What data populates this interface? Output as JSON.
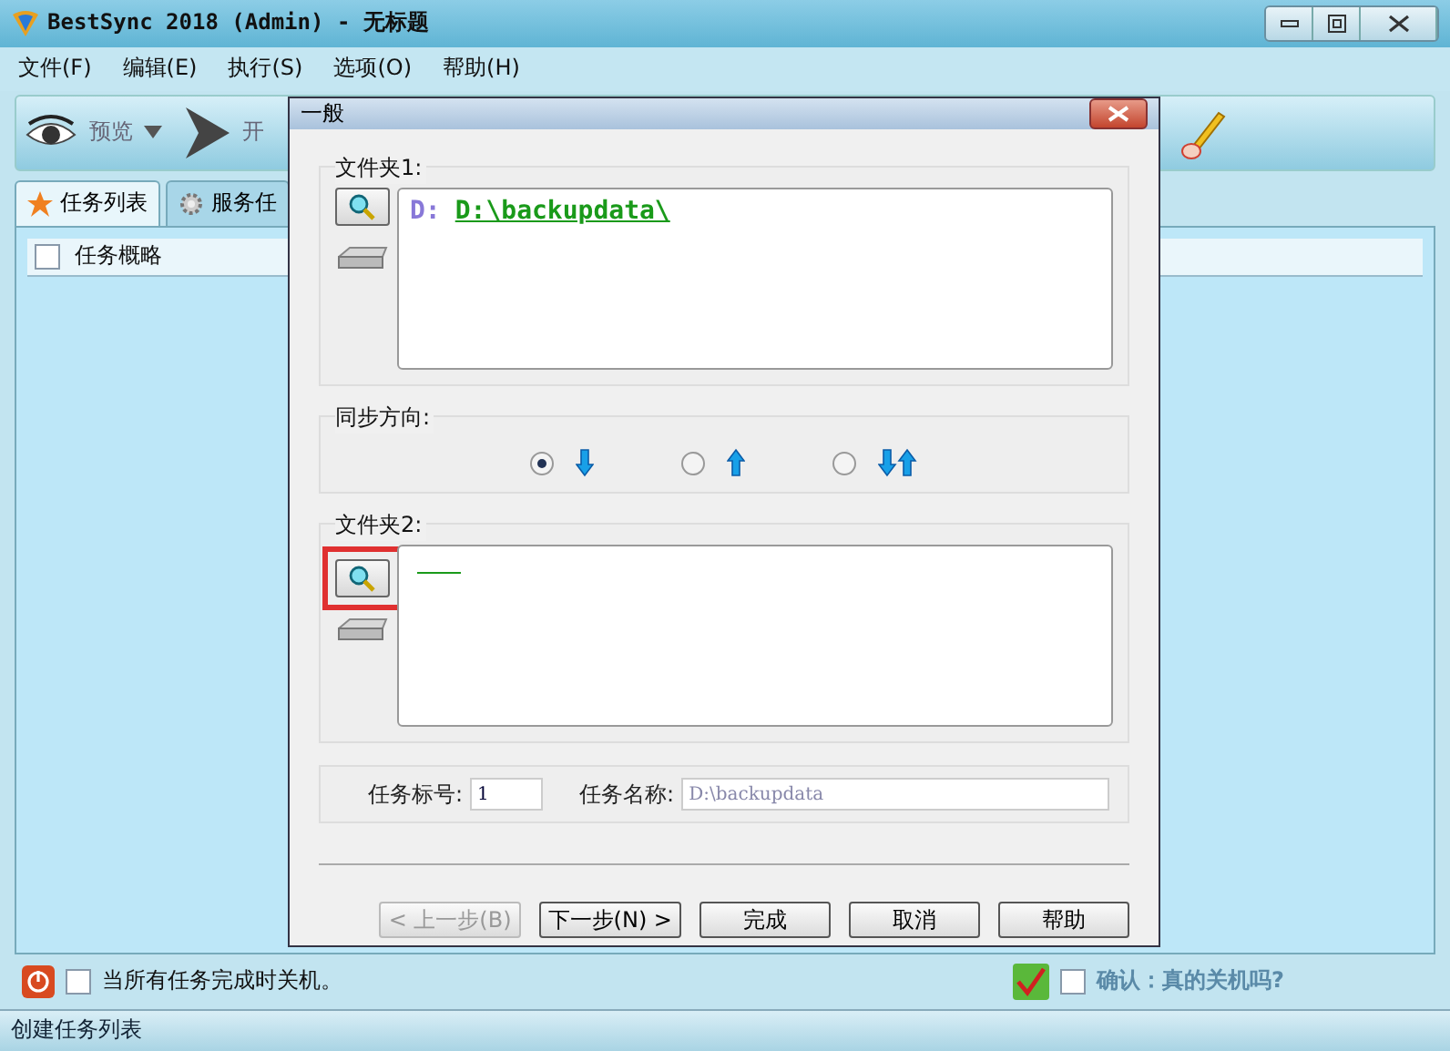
{
  "window": {
    "title": "BestSync 2018 (Admin) - 无标题"
  },
  "menu": [
    "文件(F)",
    "编辑(E)",
    "执行(S)",
    "选项(O)",
    "帮助(H)"
  ],
  "toolbar": [
    "预览",
    "开"
  ],
  "tabs": [
    {
      "label": "任务列表",
      "selected": true
    },
    {
      "label": "服务任",
      "selected": false
    }
  ],
  "list": {
    "header": "任务概略",
    "checked": false
  },
  "footer": {
    "shutdown": {
      "label": "当所有任务完成时关机。",
      "checked": false
    },
    "confirm": {
      "label": "确认：真的关机吗?",
      "checked": false
    }
  },
  "status_bar": "创建任务列表",
  "dialog": {
    "title": "一般",
    "folder1": {
      "label": "文件夹1:",
      "drive": "D:",
      "path": "D:\\backupdata\\"
    },
    "direction": {
      "label": "同步方向:",
      "options": [
        {
          "kind": "down",
          "selected": true
        },
        {
          "kind": "up",
          "selected": false
        },
        {
          "kind": "both",
          "selected": false
        }
      ]
    },
    "folder2": {
      "label": "文件夹2:"
    },
    "task_number": {
      "label": "任务标号:",
      "value": "1"
    },
    "task_name": {
      "label": "任务名称:",
      "value": "D:\\backupdata"
    },
    "buttons": [
      {
        "label": "< 上一步(B)",
        "disabled": true
      },
      {
        "label": "下一步(N) >",
        "disabled": false
      },
      {
        "label": "完成",
        "disabled": false
      },
      {
        "label": "取消",
        "disabled": false
      },
      {
        "label": "帮助",
        "disabled": false
      }
    ]
  }
}
